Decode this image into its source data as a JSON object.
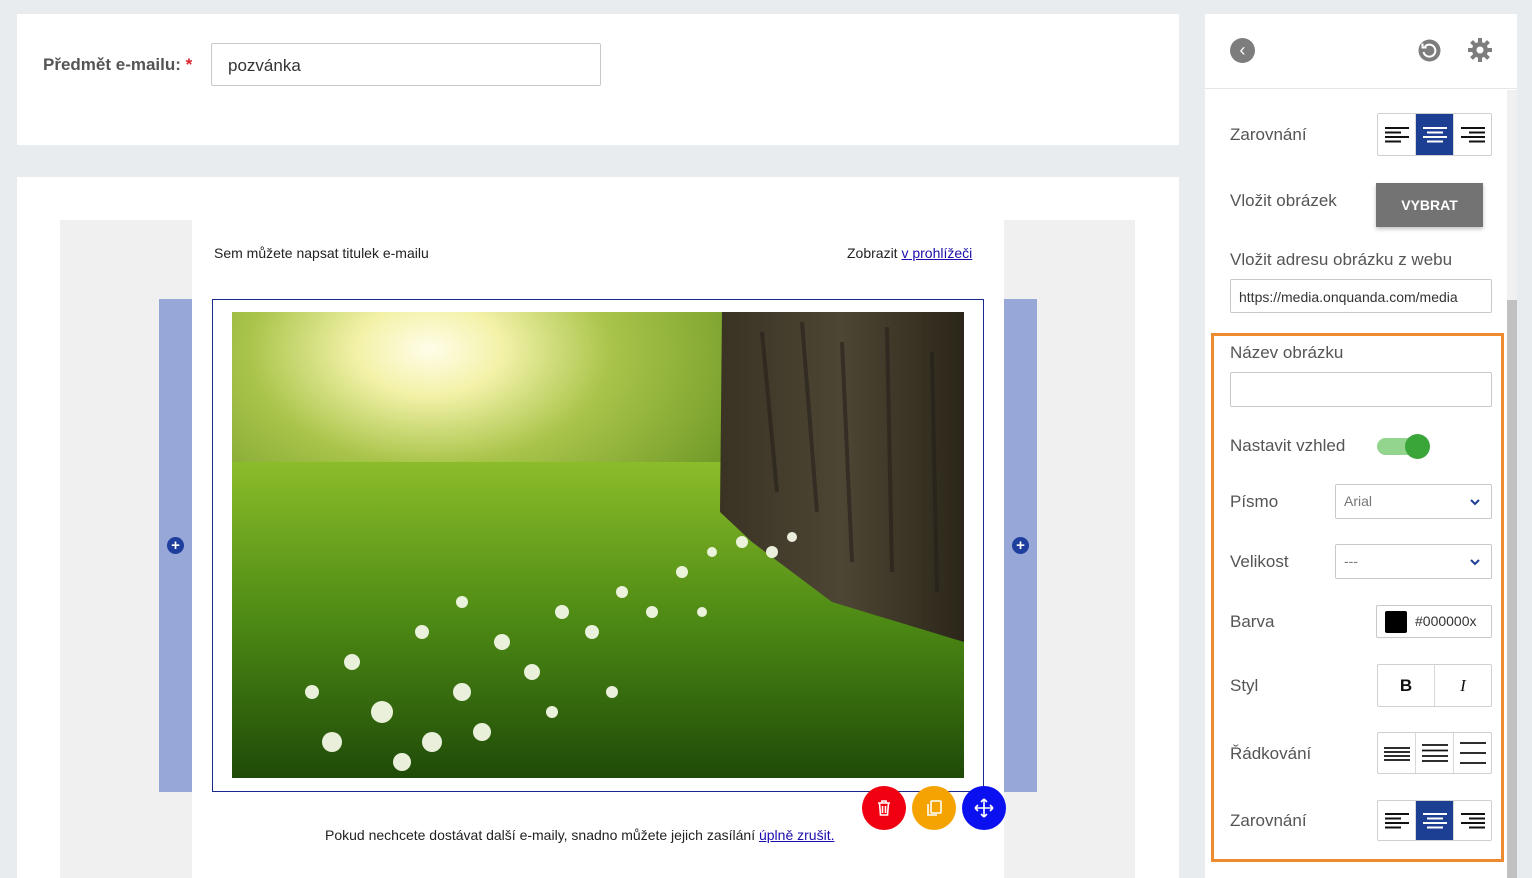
{
  "subject": {
    "label": "Předmět e-mailu:",
    "required_mark": "*",
    "value": "pozvánka"
  },
  "email": {
    "title_placeholder": "Sem můžete napsat titulek e-mailu",
    "view_prefix": "Zobrazit",
    "view_link": "v prohlížeči",
    "footer_text": "Pokud nechcete dostávat další e-maily, snadno můžete jejich zasílání",
    "footer_link": "úplně zrušit."
  },
  "block_actions": {
    "delete": "trash-icon",
    "copy": "copy-icon",
    "move": "move-icon",
    "colors": {
      "delete": "#f00010",
      "copy": "#f5a300",
      "move": "#0a10f0"
    }
  },
  "settings": {
    "align_label": "Zarovnání",
    "insert_image_label": "Vložit obrázek",
    "choose_button": "VYBRAT",
    "url_label": "Vložit adresu obrázku z webu",
    "url_value": "https://media.onquanda.com/media",
    "image_name_label": "Název obrázku",
    "image_name_value": "",
    "appearance_label": "Nastavit vzhled",
    "appearance_enabled": true,
    "font_label": "Písmo",
    "font_value": "Arial",
    "size_label": "Velikost",
    "size_value": "---",
    "color_label": "Barva",
    "color_value": "#000000x",
    "style_label": "Styl",
    "bold": "B",
    "italic": "I",
    "spacing_label": "Řádkování",
    "align2_label": "Zarovnání",
    "active_align": "center",
    "accent_color": "#1c3f94",
    "highlight_color": "#f08a30"
  }
}
